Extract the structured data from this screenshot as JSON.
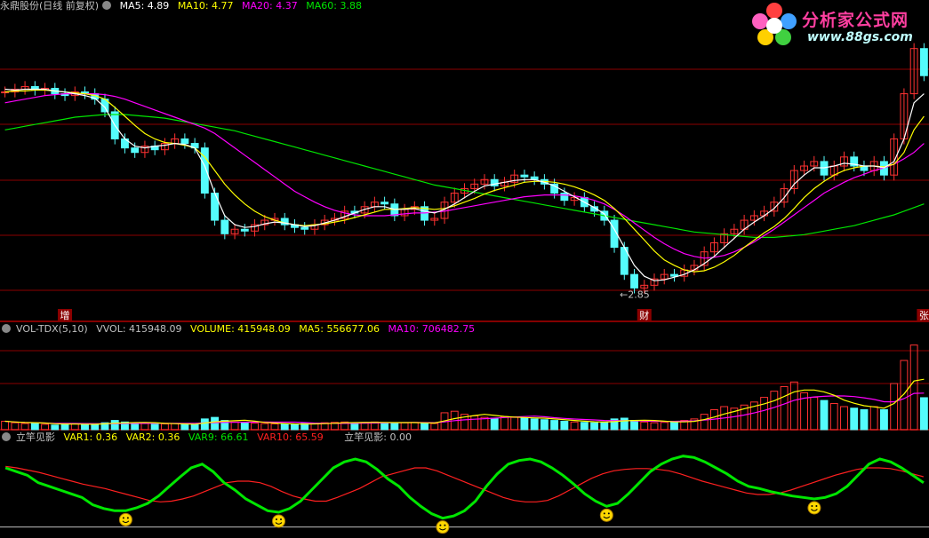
{
  "main_header": {
    "stock": "永鼎股份(日线 前复权)",
    "ma5": "MA5: 4.89",
    "ma10": "MA10: 4.77",
    "ma20": "MA20: 4.37",
    "ma60": "MA60: 3.88"
  },
  "vol_header": {
    "name": "VOL-TDX(5,10)",
    "vvol": "VVOL: 415948.09",
    "volume": "VOLUME: 415948.09",
    "ma5": "MA5: 556677.06",
    "ma10": "MA10: 706482.75"
  },
  "ind_header": {
    "name": "立竿见影",
    "var1": "VAR1: 0.36",
    "var2": "VAR2: 0.36",
    "var9": "VAR9: 66.61",
    "var10": "VAR10: 65.59",
    "signal": "立竿见影: 0.00"
  },
  "logo": {
    "title": "分析家公式网",
    "url": "www.88gs.com"
  },
  "colors": {
    "up": "#ff3232",
    "down": "#54fcfc",
    "ma5": "#ffffff",
    "ma10": "#ffff00",
    "ma20": "#ff00ff",
    "ma60": "#00e600",
    "grid": "#8b0000",
    "var9": "#00e600",
    "var10": "#ff2020"
  },
  "chart_data": [
    {
      "type": "candlestick",
      "title": "永鼎股份(日线 前复权)",
      "ylim": [
        2.6,
        6.0
      ],
      "annotations": [
        {
          "label": "2.85",
          "index": 61
        },
        {
          "label": "增",
          "index": 6
        },
        {
          "label": "财",
          "index": 64
        },
        {
          "label": "张",
          "index": 92
        }
      ],
      "close": [
        5.12,
        5.15,
        5.18,
        5.14,
        5.16,
        5.1,
        5.08,
        5.12,
        5.1,
        5.04,
        4.9,
        4.6,
        4.5,
        4.45,
        4.52,
        4.48,
        4.55,
        4.6,
        4.55,
        4.5,
        4.0,
        3.7,
        3.55,
        3.6,
        3.58,
        3.65,
        3.7,
        3.72,
        3.65,
        3.62,
        3.6,
        3.65,
        3.7,
        3.72,
        3.8,
        3.78,
        3.85,
        3.9,
        3.88,
        3.75,
        3.82,
        3.85,
        3.7,
        3.72,
        3.9,
        4.0,
        4.05,
        4.1,
        4.15,
        4.08,
        4.12,
        4.2,
        4.18,
        4.15,
        4.1,
        4.0,
        3.92,
        3.95,
        3.85,
        3.8,
        3.7,
        3.4,
        3.1,
        2.95,
        2.98,
        3.05,
        3.1,
        3.08,
        3.15,
        3.2,
        3.35,
        3.45,
        3.55,
        3.6,
        3.7,
        3.75,
        3.8,
        3.9,
        4.05,
        4.25,
        4.3,
        4.35,
        4.2,
        4.3,
        4.4,
        4.3,
        4.25,
        4.35,
        4.2,
        4.6,
        5.1,
        5.6,
        5.3
      ],
      "ma5": [
        5.15,
        5.14,
        5.15,
        5.15,
        5.15,
        5.13,
        5.12,
        5.1,
        5.08,
        5.05,
        4.95,
        4.75,
        4.6,
        4.52,
        4.5,
        4.52,
        4.53,
        4.55,
        4.54,
        4.5,
        4.3,
        4.0,
        3.75,
        3.65,
        3.62,
        3.63,
        3.66,
        3.68,
        3.67,
        3.65,
        3.63,
        3.64,
        3.67,
        3.7,
        3.74,
        3.78,
        3.82,
        3.85,
        3.85,
        3.82,
        3.82,
        3.83,
        3.8,
        3.78,
        3.82,
        3.88,
        3.95,
        4.02,
        4.08,
        4.1,
        4.12,
        4.14,
        4.15,
        4.15,
        4.12,
        4.08,
        4.02,
        3.96,
        3.9,
        3.84,
        3.77,
        3.6,
        3.4,
        3.2,
        3.08,
        3.03,
        3.04,
        3.07,
        3.1,
        3.15,
        3.22,
        3.3,
        3.4,
        3.5,
        3.6,
        3.68,
        3.75,
        3.83,
        3.95,
        4.1,
        4.2,
        4.28,
        4.28,
        4.3,
        4.33,
        4.32,
        4.3,
        4.3,
        4.28,
        4.35,
        4.6,
        5.0,
        5.1
      ],
      "ma10": [
        5.12,
        5.13,
        5.13,
        5.14,
        5.14,
        5.13,
        5.12,
        5.11,
        5.1,
        5.08,
        5.04,
        4.95,
        4.85,
        4.75,
        4.66,
        4.6,
        4.56,
        4.55,
        4.53,
        4.5,
        4.4,
        4.25,
        4.1,
        3.98,
        3.88,
        3.8,
        3.74,
        3.7,
        3.67,
        3.65,
        3.64,
        3.65,
        3.66,
        3.68,
        3.7,
        3.73,
        3.76,
        3.79,
        3.82,
        3.82,
        3.83,
        3.84,
        3.83,
        3.82,
        3.83,
        3.86,
        3.9,
        3.94,
        3.99,
        4.03,
        4.06,
        4.09,
        4.12,
        4.13,
        4.13,
        4.12,
        4.1,
        4.07,
        4.03,
        3.98,
        3.92,
        3.83,
        3.72,
        3.6,
        3.48,
        3.36,
        3.26,
        3.2,
        3.15,
        3.13,
        3.14,
        3.18,
        3.24,
        3.31,
        3.4,
        3.48,
        3.56,
        3.63,
        3.72,
        3.83,
        3.95,
        4.05,
        4.13,
        4.2,
        4.25,
        4.28,
        4.3,
        4.3,
        4.29,
        4.32,
        4.45,
        4.7,
        4.85
      ],
      "ma20": [
        5.0,
        5.02,
        5.04,
        5.06,
        5.08,
        5.09,
        5.1,
        5.1,
        5.1,
        5.1,
        5.09,
        5.07,
        5.04,
        5.0,
        4.96,
        4.92,
        4.88,
        4.84,
        4.8,
        4.76,
        4.72,
        4.66,
        4.58,
        4.5,
        4.42,
        4.34,
        4.26,
        4.18,
        4.1,
        4.02,
        3.96,
        3.9,
        3.85,
        3.81,
        3.78,
        3.76,
        3.75,
        3.75,
        3.75,
        3.76,
        3.77,
        3.78,
        3.78,
        3.79,
        3.8,
        3.82,
        3.84,
        3.86,
        3.88,
        3.9,
        3.92,
        3.94,
        3.96,
        3.97,
        3.98,
        3.98,
        3.98,
        3.97,
        3.95,
        3.92,
        3.88,
        3.82,
        3.75,
        3.67,
        3.59,
        3.51,
        3.44,
        3.38,
        3.33,
        3.3,
        3.28,
        3.29,
        3.31,
        3.35,
        3.4,
        3.46,
        3.53,
        3.6,
        3.68,
        3.76,
        3.84,
        3.92,
        4.0,
        4.06,
        4.12,
        4.17,
        4.21,
        4.25,
        4.28,
        4.32,
        4.38,
        4.45,
        4.55
      ],
      "ma60": [
        4.7,
        4.72,
        4.74,
        4.76,
        4.78,
        4.8,
        4.82,
        4.84,
        4.85,
        4.86,
        4.87,
        4.87,
        4.87,
        4.86,
        4.85,
        4.84,
        4.83,
        4.81,
        4.79,
        4.77,
        4.75,
        4.73,
        4.71,
        4.69,
        4.66,
        4.63,
        4.6,
        4.57,
        4.54,
        4.51,
        4.48,
        4.45,
        4.42,
        4.39,
        4.36,
        4.33,
        4.3,
        4.27,
        4.24,
        4.21,
        4.18,
        4.15,
        4.12,
        4.09,
        4.07,
        4.05,
        4.03,
        4.01,
        3.99,
        3.97,
        3.95,
        3.93,
        3.91,
        3.89,
        3.87,
        3.85,
        3.83,
        3.81,
        3.79,
        3.77,
        3.75,
        3.73,
        3.71,
        3.69,
        3.67,
        3.65,
        3.63,
        3.61,
        3.59,
        3.57,
        3.56,
        3.55,
        3.54,
        3.53,
        3.52,
        3.51,
        3.51,
        3.51,
        3.52,
        3.53,
        3.54,
        3.56,
        3.58,
        3.6,
        3.62,
        3.64,
        3.67,
        3.7,
        3.73,
        3.76,
        3.8,
        3.84,
        3.88
      ]
    },
    {
      "type": "bar",
      "title": "VOL-TDX(5,10)",
      "ylim": [
        0,
        1200000
      ],
      "values": [
        110000,
        90000,
        80000,
        85000,
        70000,
        60000,
        75000,
        80000,
        70000,
        65000,
        90000,
        120000,
        100000,
        85000,
        80000,
        70000,
        75000,
        80000,
        70000,
        65000,
        140000,
        160000,
        120000,
        100000,
        90000,
        85000,
        80000,
        75000,
        70000,
        65000,
        80000,
        85000,
        90000,
        95000,
        100000,
        90000,
        95000,
        100000,
        90000,
        85000,
        90000,
        95000,
        85000,
        80000,
        220000,
        240000,
        200000,
        180000,
        160000,
        150000,
        170000,
        160000,
        150000,
        140000,
        130000,
        120000,
        110000,
        100000,
        95000,
        90000,
        100000,
        140000,
        150000,
        120000,
        100000,
        90000,
        95000,
        100000,
        120000,
        140000,
        200000,
        260000,
        300000,
        280000,
        320000,
        360000,
        420000,
        500000,
        560000,
        620000,
        480000,
        420000,
        380000,
        340000,
        300000,
        280000,
        260000,
        300000,
        260000,
        600000,
        900000,
        1100000,
        415948
      ],
      "ma5_last": 556677.06,
      "ma10_last": 706482.75
    },
    {
      "type": "line",
      "title": "立竿见影",
      "ylim": [
        -10,
        110
      ],
      "series": [
        {
          "name": "VAR9",
          "values": [
            80,
            75,
            70,
            60,
            55,
            50,
            45,
            40,
            30,
            25,
            22,
            22,
            26,
            32,
            42,
            55,
            68,
            80,
            85,
            75,
            60,
            50,
            38,
            30,
            22,
            20,
            25,
            35,
            50,
            65,
            80,
            88,
            92,
            88,
            78,
            65,
            55,
            40,
            28,
            18,
            12,
            15,
            22,
            35,
            55,
            72,
            85,
            90,
            92,
            88,
            80,
            70,
            58,
            45,
            35,
            28,
            32,
            45,
            60,
            75,
            85,
            92,
            96,
            94,
            88,
            80,
            72,
            62,
            55,
            52,
            48,
            45,
            42,
            40,
            38,
            40,
            45,
            55,
            70,
            85,
            92,
            88,
            80,
            70,
            60
          ]
        },
        {
          "name": "VAR10",
          "values": [
            82,
            80,
            77,
            74,
            70,
            66,
            62,
            58,
            55,
            52,
            48,
            44,
            40,
            36,
            34,
            35,
            38,
            42,
            48,
            54,
            60,
            62,
            62,
            60,
            55,
            48,
            42,
            38,
            35,
            35,
            40,
            46,
            52,
            60,
            68,
            72,
            76,
            80,
            80,
            76,
            70,
            64,
            58,
            52,
            46,
            40,
            36,
            34,
            34,
            36,
            42,
            50,
            58,
            66,
            72,
            76,
            78,
            79,
            79,
            78,
            76,
            72,
            67,
            62,
            58,
            54,
            50,
            46,
            44,
            44,
            46,
            50,
            55,
            60,
            65,
            70,
            74,
            78,
            80,
            80,
            79,
            76,
            72,
            68
          ]
        }
      ],
      "var1": 0.36,
      "var2": 0.36,
      "var9_last": 66.61,
      "var10_last": 65.59,
      "signal": 0.0
    }
  ]
}
